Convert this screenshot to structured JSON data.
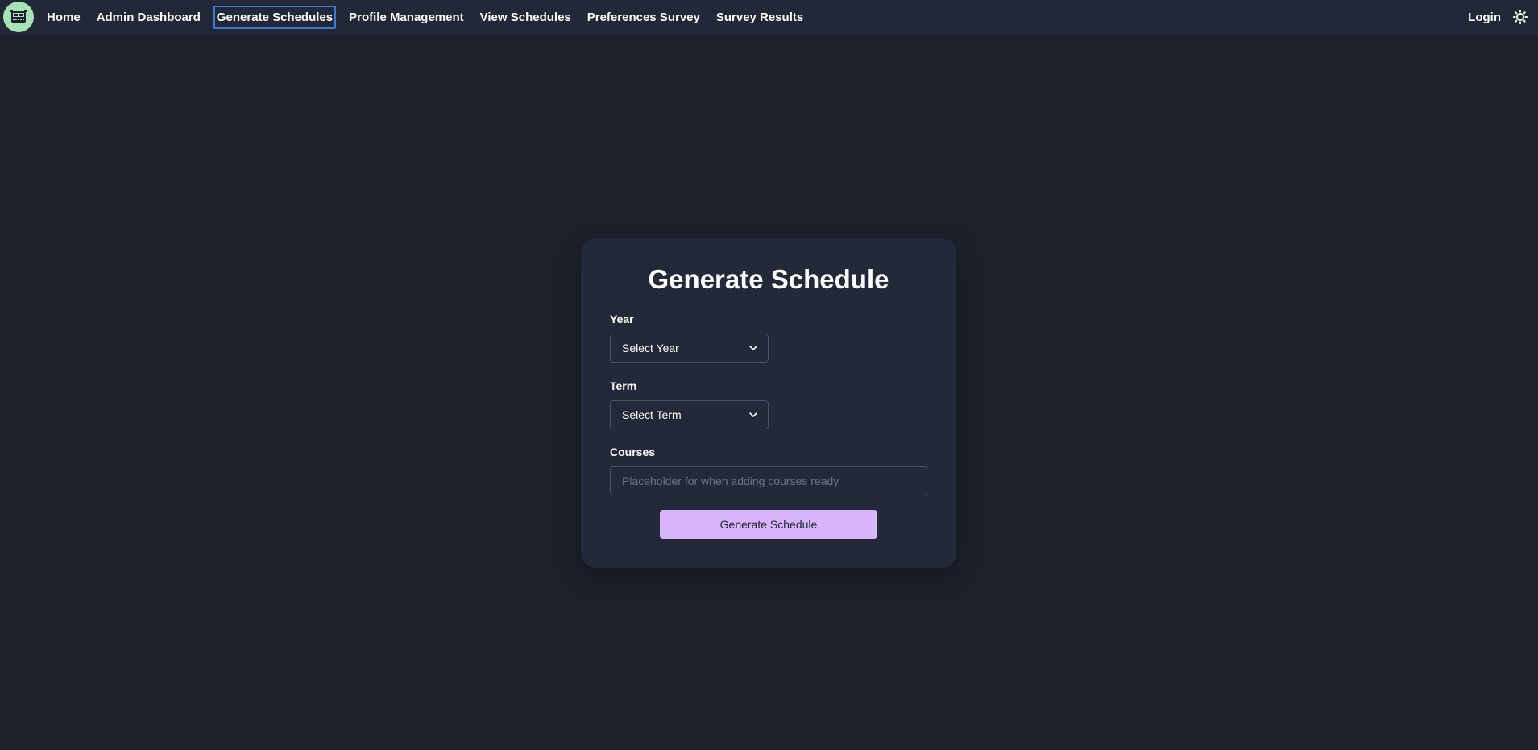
{
  "nav": {
    "logo_icon": "school-bus-icon",
    "items": [
      {
        "label": "Home"
      },
      {
        "label": "Admin Dashboard"
      },
      {
        "label": "Generate Schedules",
        "active": true
      },
      {
        "label": "Profile Management"
      },
      {
        "label": "View Schedules"
      },
      {
        "label": "Preferences Survey"
      },
      {
        "label": "Survey Results"
      }
    ],
    "login_label": "Login",
    "theme_icon": "sun-icon"
  },
  "form": {
    "title": "Generate Schedule",
    "year_label": "Year",
    "year_value": "Select Year",
    "term_label": "Term",
    "term_value": "Select Term",
    "courses_label": "Courses",
    "courses_placeholder": "Placeholder for when adding courses ready",
    "courses_value": "",
    "submit_label": "Generate Schedule"
  },
  "colors": {
    "background": "#1c212c",
    "navbar": "#222838",
    "card": "#232938",
    "accent": "#d9b6fb",
    "logo": "#a6e3b7",
    "active_outline": "#3a7bd5"
  }
}
